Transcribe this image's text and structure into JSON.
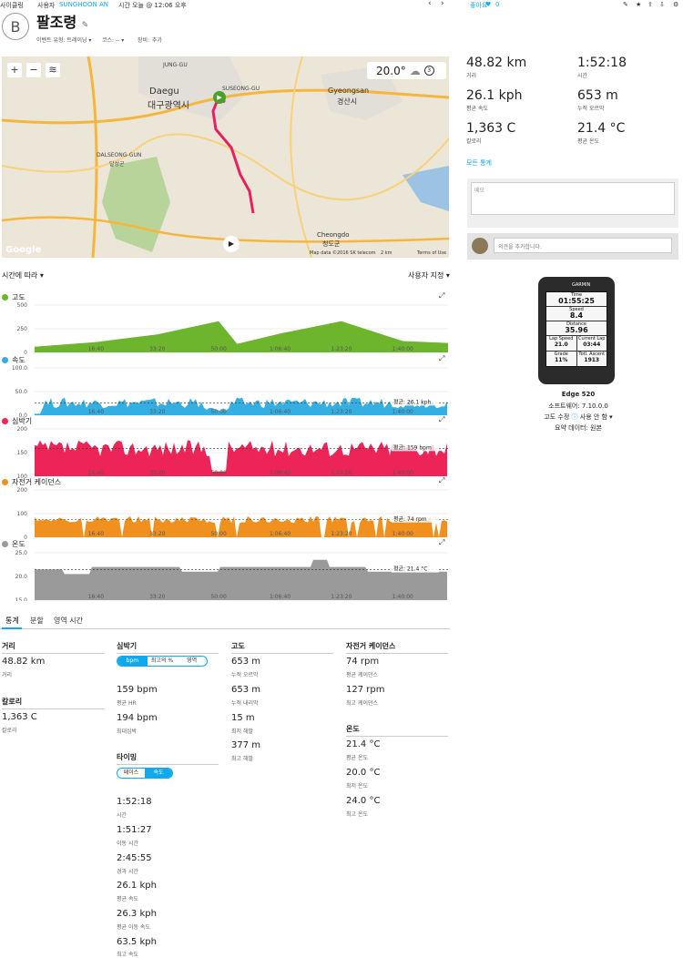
{
  "topbar": {
    "section": "사이클링",
    "user_prefix": "사용자",
    "user_name": "SUNGHOON AN",
    "time": "시간 오늘 @ 12:06 오후",
    "likes_label": "좋아요",
    "likes_count": "0"
  },
  "activity": {
    "avatar_letter": "B",
    "title": "팔조령",
    "event_type": "이벤트 유형: 트레이닝 ▾",
    "course": "코스: -- ▾",
    "gear_label": "장비:",
    "gear_add": "추가"
  },
  "map": {
    "weather_temp": "20.0°",
    "weather_count": "3",
    "places": [
      "JUNG-GU",
      "Daegu",
      "대구광역시",
      "Gyeongsan",
      "경산시",
      "DALSEONG-GUN",
      "달성군",
      "Cheongdo",
      "청도군",
      "SUSEONG-GU"
    ],
    "attribution": "Map data ©2016 SK telecom",
    "scale": "2 km",
    "terms": "Terms of Use",
    "logo": "Google"
  },
  "summary": {
    "stats": [
      {
        "value": "48.82 km",
        "label": "거리"
      },
      {
        "value": "1:52:18",
        "label": "시간"
      },
      {
        "value": "26.1 kph",
        "label": "평균 속도"
      },
      {
        "value": "653 m",
        "label": "누적 오르막"
      },
      {
        "value": "1,363 C",
        "label": "칼로리"
      },
      {
        "value": "21.4 °C",
        "label": "평균 온도"
      }
    ],
    "all_stats_link": "모든 통계",
    "note_placeholder": "메모",
    "comment_placeholder": "의견을 추가합니다."
  },
  "charts": {
    "mode": "시간에 따라 ▾",
    "custom": "사용자 지정 ▾",
    "x_ticks": [
      "16:40",
      "33:20",
      "50:00",
      "1:06:40",
      "1:23:20",
      "1:40:00"
    ],
    "list": [
      {
        "title": "고도",
        "color": "#6cb52d",
        "y_ticks": [
          "500",
          "250",
          "0"
        ],
        "ylim": [
          0,
          500
        ],
        "avg_label": ""
      },
      {
        "title": "속도",
        "color": "#35aee2",
        "y_ticks": [
          "100.0",
          "50.0",
          "0.0"
        ],
        "ylim": [
          0,
          100
        ],
        "avg_label": "평균: 26.1 kph"
      },
      {
        "title": "심박기",
        "color": "#ec2457",
        "y_ticks": [
          "200",
          "150",
          "100"
        ],
        "ylim": [
          100,
          200
        ],
        "avg_label": "평균: 159 bpm"
      },
      {
        "title": "자전거 케이던스",
        "color": "#f0901e",
        "y_ticks": [
          "200",
          "100",
          "0"
        ],
        "ylim": [
          0,
          200
        ],
        "avg_label": "평균: 74 rpm"
      },
      {
        "title": "온도",
        "color": "#9a9a9a",
        "y_ticks": [
          "25.0",
          "20.0",
          "15.0"
        ],
        "ylim": [
          15,
          25
        ],
        "avg_label": "평균: 21.4 °C"
      }
    ]
  },
  "chart_data": [
    {
      "type": "area",
      "title": "고도",
      "x": [
        0,
        16.7,
        33.3,
        50,
        55,
        66.7,
        83.3,
        100,
        112.3
      ],
      "y": [
        60,
        110,
        190,
        330,
        90,
        200,
        330,
        120,
        100
      ],
      "ylim": [
        0,
        500
      ],
      "x_unit": "min"
    },
    {
      "type": "area",
      "title": "속도",
      "avg": 26.1,
      "ylim": [
        0,
        100
      ]
    },
    {
      "type": "area",
      "title": "심박기",
      "avg": 159,
      "max": 194,
      "ylim": [
        100,
        200
      ]
    },
    {
      "type": "area",
      "title": "자전거 케이던스",
      "avg": 74,
      "max": 127,
      "ylim": [
        0,
        200
      ]
    },
    {
      "type": "area",
      "title": "온도",
      "avg": 21.4,
      "min": 20.0,
      "max": 24.0,
      "ylim": [
        15,
        25
      ]
    }
  ],
  "tabs": [
    "통계",
    "분할",
    "영역 시간"
  ],
  "stats": {
    "distance": {
      "header": "거리",
      "value": "48.82 km",
      "label": "거리"
    },
    "calories": {
      "header": "칼로리",
      "value": "1,363 C",
      "label": "칼로리"
    },
    "hr": {
      "header": "심박기",
      "seg": [
        "bpm",
        "최고의 %",
        "영역"
      ],
      "items": [
        {
          "value": "159 bpm",
          "label": "평균 HR"
        },
        {
          "value": "194 bpm",
          "label": "최대심박"
        }
      ]
    },
    "timing": {
      "header": "타이밍",
      "seg": [
        "페이스",
        "속도"
      ],
      "items": [
        {
          "value": "1:52:18",
          "label": "시간"
        },
        {
          "value": "1:51:27",
          "label": "이동 시간"
        },
        {
          "value": "2:45:55",
          "label": "경과 시간"
        },
        {
          "value": "26.1 kph",
          "label": "평균 속도"
        },
        {
          "value": "26.3 kph",
          "label": "평균 이동 속도"
        },
        {
          "value": "63.5 kph",
          "label": "최고 속도"
        }
      ]
    },
    "elevation": {
      "header": "고도",
      "items": [
        {
          "value": "653 m",
          "label": "누적 오르막"
        },
        {
          "value": "653 m",
          "label": "누적 내리막"
        },
        {
          "value": "15 m",
          "label": "최저 해발"
        },
        {
          "value": "377 m",
          "label": "최고 해발"
        }
      ]
    },
    "cadence": {
      "header": "자전거 케이던스",
      "items": [
        {
          "value": "74 rpm",
          "label": "평균 케이던스"
        },
        {
          "value": "127 rpm",
          "label": "최고 케이던스"
        }
      ]
    },
    "temperature": {
      "header": "온도",
      "items": [
        {
          "value": "21.4 °C",
          "label": "평균 온도"
        },
        {
          "value": "20.0 °C",
          "label": "최저 온도"
        },
        {
          "value": "24.0 °C",
          "label": "최고 온도"
        }
      ]
    }
  },
  "device": {
    "brand": "GARMIN",
    "screen": [
      {
        "label": "Time",
        "value": "01:55:25"
      },
      {
        "label": "Speed",
        "value": "8.4"
      },
      {
        "label": "Distance",
        "value": "35.96"
      }
    ],
    "grid": [
      {
        "label": "Lap Speed",
        "value": "21.0"
      },
      {
        "label": "Current Lap",
        "value": "03:44"
      },
      {
        "label": "Grade",
        "value": "11%"
      },
      {
        "label": "Totl. Ascent",
        "value": "1913"
      }
    ],
    "name": "Edge 520",
    "software": "소프트웨어: 7.10.0.0",
    "elev_label": "고도 수정",
    "elev_value": "사용 안 함 ▾",
    "summary_data": "요약 데이터: 원본"
  }
}
